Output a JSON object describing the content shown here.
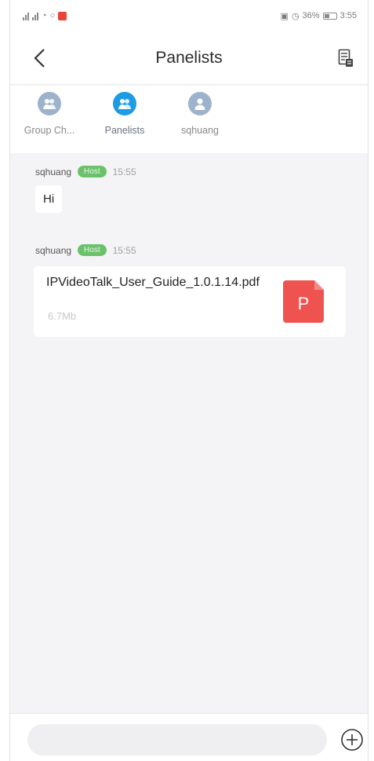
{
  "status_bar": {
    "battery_percent": "36%",
    "time": "3:55"
  },
  "nav": {
    "title": "Panelists",
    "back_icon": "chevron-left-icon",
    "right_icon": "document-list-icon"
  },
  "tabs": [
    {
      "label": "Group Ch...",
      "icon": "group-avatar-icon",
      "active": false
    },
    {
      "label": "Panelists",
      "icon": "group-avatar-icon",
      "active": true
    },
    {
      "label": "sqhuang",
      "icon": "user-avatar-icon",
      "active": false
    }
  ],
  "messages": [
    {
      "sender": "sqhuang",
      "badge": "Host",
      "time": "15:55",
      "text": "Hi"
    },
    {
      "sender": "sqhuang",
      "badge": "Host",
      "time": "15:55",
      "file": {
        "name": "IPVideoTalk_User_Guide_1.0.1.14.pdf",
        "size": "6.7Mb",
        "icon_letter": "P"
      }
    }
  ],
  "input": {
    "placeholder": ""
  },
  "colors": {
    "accent": "#1d9be3",
    "host_badge": "#6bc26a",
    "file_icon": "#ef5350"
  }
}
